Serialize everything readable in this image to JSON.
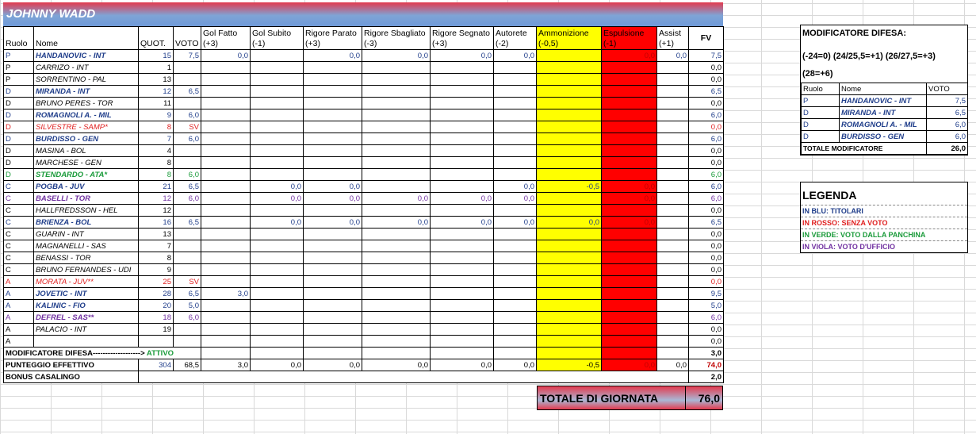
{
  "team_name": "JOHNNY WADD",
  "headers": [
    "Ruolo",
    "Nome",
    "QUOT.",
    "VOTO",
    "Gol Fatto (+3)",
    "Gol Subito (-1)",
    "Rigore Parato (+3)",
    "Rigore Sbagliato (-3)",
    "Rigore Segnato (+3)",
    "Autorete (-2)",
    "Ammonizione (-0,5)",
    "Espulsione (-1)",
    "Assist (+1)",
    "FV"
  ],
  "rows": [
    {
      "role": "P",
      "name": "HANDANOVIC - INT",
      "quot": "15",
      "voto": "7,5",
      "gf": "0,0",
      "gs": "",
      "rp": "0,0",
      "rs": "0,0",
      "rse": "0,0",
      "aut": "0,0",
      "amm": "",
      "esp": "0,0",
      "ass": "0,0",
      "fv": "7,5",
      "style": "blue"
    },
    {
      "role": "P",
      "name": "CARRIZO - INT",
      "quot": "1",
      "voto": "",
      "gf": "",
      "gs": "",
      "rp": "",
      "rs": "",
      "rse": "",
      "aut": "",
      "amm": "",
      "esp": "",
      "ass": "",
      "fv": "0,0",
      "style": "plain"
    },
    {
      "role": "P",
      "name": "SORRENTINO - PAL",
      "quot": "13",
      "voto": "",
      "gf": "",
      "gs": "",
      "rp": "",
      "rs": "",
      "rse": "",
      "aut": "",
      "amm": "",
      "esp": "",
      "ass": "",
      "fv": "0,0",
      "style": "plain"
    },
    {
      "role": "D",
      "name": "MIRANDA - INT",
      "quot": "12",
      "voto": "6,5",
      "gf": "",
      "gs": "",
      "rp": "",
      "rs": "",
      "rse": "",
      "aut": "",
      "amm": "",
      "esp": "",
      "ass": "",
      "fv": "6,5",
      "style": "blue"
    },
    {
      "role": "D",
      "name": "BRUNO PERES - TOR",
      "quot": "11",
      "voto": "",
      "gf": "",
      "gs": "",
      "rp": "",
      "rs": "",
      "rse": "",
      "aut": "",
      "amm": "",
      "esp": "",
      "ass": "",
      "fv": "0,0",
      "style": "plain"
    },
    {
      "role": "D",
      "name": "ROMAGNOLI A. - MIL",
      "quot": "9",
      "voto": "6,0",
      "gf": "",
      "gs": "",
      "rp": "",
      "rs": "",
      "rse": "",
      "aut": "",
      "amm": "",
      "esp": "",
      "ass": "",
      "fv": "6,0",
      "style": "blue"
    },
    {
      "role": "D",
      "name": "SILVESTRE - SAMP*",
      "quot": "8",
      "voto": "SV",
      "gf": "",
      "gs": "",
      "rp": "",
      "rs": "",
      "rse": "",
      "aut": "",
      "amm": "",
      "esp": "",
      "ass": "",
      "fv": "0,0",
      "style": "redt"
    },
    {
      "role": "D",
      "name": "BURDISSO - GEN",
      "quot": "7",
      "voto": "6,0",
      "gf": "",
      "gs": "",
      "rp": "",
      "rs": "",
      "rse": "",
      "aut": "",
      "amm": "",
      "esp": "",
      "ass": "",
      "fv": "6,0",
      "style": "blue"
    },
    {
      "role": "D",
      "name": "MASINA - BOL",
      "quot": "4",
      "voto": "",
      "gf": "",
      "gs": "",
      "rp": "",
      "rs": "",
      "rse": "",
      "aut": "",
      "amm": "",
      "esp": "",
      "ass": "",
      "fv": "0,0",
      "style": "plain"
    },
    {
      "role": "D",
      "name": "MARCHESE - GEN",
      "quot": "8",
      "voto": "",
      "gf": "",
      "gs": "",
      "rp": "",
      "rs": "",
      "rse": "",
      "aut": "",
      "amm": "",
      "esp": "",
      "ass": "",
      "fv": "0,0",
      "style": "plain"
    },
    {
      "role": "D",
      "name": "STENDARDO - ATA*",
      "quot": "8",
      "voto": "6,0",
      "gf": "",
      "gs": "",
      "rp": "",
      "rs": "",
      "rse": "",
      "aut": "",
      "amm": "",
      "esp": "",
      "ass": "",
      "fv": "6,0",
      "style": "green"
    },
    {
      "role": "C",
      "name": "POGBA - JUV",
      "quot": "21",
      "voto": "6,5",
      "gf": "",
      "gs": "0,0",
      "rp": "0,0",
      "rs": "",
      "rse": "",
      "aut": "0,0",
      "amm": "-0,5",
      "esp": "0,0",
      "ass": "",
      "fv": "6,0",
      "style": "blue"
    },
    {
      "role": "C",
      "name": "BASELLI - TOR",
      "quot": "12",
      "voto": "6,0",
      "gf": "",
      "gs": "0,0",
      "rp": "0,0",
      "rs": "0,0",
      "rse": "0,0",
      "aut": "0,0",
      "amm": "",
      "esp": "0,0",
      "ass": "",
      "fv": "6,0",
      "style": "viola"
    },
    {
      "role": "C",
      "name": "HALLFREDSSON - HEL",
      "quot": "12",
      "voto": "",
      "gf": "",
      "gs": "",
      "rp": "",
      "rs": "",
      "rse": "",
      "aut": "",
      "amm": "",
      "esp": "",
      "ass": "",
      "fv": "0,0",
      "style": "plain"
    },
    {
      "role": "C",
      "name": "BRIENZA - BOL",
      "quot": "16",
      "voto": "6,5",
      "gf": "",
      "gs": "0,0",
      "rp": "0,0",
      "rs": "0,0",
      "rse": "0,0",
      "aut": "0,0",
      "amm": "0,0",
      "esp": "0,0",
      "ass": "",
      "fv": "6,5",
      "style": "blue"
    },
    {
      "role": "C",
      "name": "GUARIN - INT",
      "quot": "13",
      "voto": "",
      "gf": "",
      "gs": "",
      "rp": "",
      "rs": "",
      "rse": "",
      "aut": "",
      "amm": "",
      "esp": "",
      "ass": "",
      "fv": "0,0",
      "style": "plain"
    },
    {
      "role": "C",
      "name": "MAGNANELLI - SAS",
      "quot": "7",
      "voto": "",
      "gf": "",
      "gs": "",
      "rp": "",
      "rs": "",
      "rse": "",
      "aut": "",
      "amm": "",
      "esp": "",
      "ass": "",
      "fv": "0,0",
      "style": "plain"
    },
    {
      "role": "C",
      "name": "BENASSI - TOR",
      "quot": "8",
      "voto": "",
      "gf": "",
      "gs": "",
      "rp": "",
      "rs": "",
      "rse": "",
      "aut": "",
      "amm": "",
      "esp": "",
      "ass": "",
      "fv": "0,0",
      "style": "plain"
    },
    {
      "role": "C",
      "name": "BRUNO FERNANDES - UDI",
      "quot": "9",
      "voto": "",
      "gf": "",
      "gs": "",
      "rp": "",
      "rs": "",
      "rse": "",
      "aut": "",
      "amm": "",
      "esp": "",
      "ass": "",
      "fv": "0,0",
      "style": "plain"
    },
    {
      "role": "A",
      "name": "MORATA - JUV**",
      "quot": "25",
      "voto": "SV",
      "gf": "",
      "gs": "",
      "rp": "",
      "rs": "",
      "rse": "",
      "aut": "",
      "amm": "",
      "esp": "",
      "ass": "",
      "fv": "0,0",
      "style": "redt"
    },
    {
      "role": "A",
      "name": "JOVETIC - INT",
      "quot": "28",
      "voto": "6,5",
      "gf": "3,0",
      "gs": "",
      "rp": "",
      "rs": "",
      "rse": "",
      "aut": "",
      "amm": "",
      "esp": "",
      "ass": "",
      "fv": "9,5",
      "style": "blue"
    },
    {
      "role": "A",
      "name": "KALINIC - FIO",
      "quot": "20",
      "voto": "5,0",
      "gf": "",
      "gs": "",
      "rp": "",
      "rs": "",
      "rse": "",
      "aut": "",
      "amm": "",
      "esp": "",
      "ass": "",
      "fv": "5,0",
      "style": "blue"
    },
    {
      "role": "A",
      "name": "DEFREL - SAS**",
      "quot": "18",
      "voto": "6,0",
      "gf": "",
      "gs": "",
      "rp": "",
      "rs": "",
      "rse": "",
      "aut": "",
      "amm": "",
      "esp": "",
      "ass": "",
      "fv": "6,0",
      "style": "viola"
    },
    {
      "role": "A",
      "name": "PALACIO - INT",
      "quot": "19",
      "voto": "",
      "gf": "",
      "gs": "",
      "rp": "",
      "rs": "",
      "rse": "",
      "aut": "",
      "amm": "",
      "esp": "",
      "ass": "",
      "fv": "0,0",
      "style": "plain"
    },
    {
      "role": "A",
      "name": "",
      "quot": "",
      "voto": "",
      "gf": "",
      "gs": "",
      "rp": "",
      "rs": "",
      "rse": "",
      "aut": "",
      "amm": "",
      "esp": "",
      "ass": "",
      "fv": "0,0",
      "style": "plain"
    }
  ],
  "summary": {
    "mod_label": "MODIFICATORE DIFESA------------------->",
    "mod_status": "ATTIVO",
    "mod_fv": "3,0",
    "eff_label": "PUNTEGGIO EFFETTIVO",
    "eff": {
      "quot": "304",
      "voto": "68,5",
      "gf": "3,0",
      "gs": "0,0",
      "rp": "0,0",
      "rs": "0,0",
      "rse": "0,0",
      "aut": "0,0",
      "amm": "-0,5",
      "esp": "0,0",
      "ass": "0,0",
      "fv": "74,0"
    },
    "bonus_label": "BONUS CASALINGO",
    "bonus_fv": "2,0",
    "total_label": "TOTALE DI GIORNATA",
    "total_value": "76,0"
  },
  "modifier_panel": {
    "title": "MODIFICATORE DIFESA:",
    "rule1": "(-24=0) (24/25,5=+1) (26/27,5=+3)",
    "rule2": "(28=+6)",
    "headers": [
      "Ruolo",
      "Nome",
      "VOTO"
    ],
    "rows": [
      {
        "role": "P",
        "name": "HANDANOVIC - INT",
        "voto": "7,5"
      },
      {
        "role": "D",
        "name": "MIRANDA - INT",
        "voto": "6,5"
      },
      {
        "role": "D",
        "name": "ROMAGNOLI A. - MIL",
        "voto": "6,0"
      },
      {
        "role": "D",
        "name": "BURDISSO - GEN",
        "voto": "6,0"
      }
    ],
    "total_label": "TOTALE MODIFICATORE",
    "total_value": "26,0"
  },
  "legend": {
    "title": "LEGENDA",
    "items": [
      {
        "text": "IN BLU: TITOLARI",
        "color": "#1f3d8a"
      },
      {
        "text": "IN ROSSO: SENZA VOTO",
        "color": "#e02020"
      },
      {
        "text": "IN VERDE: VOTO DALLA PANCHINA",
        "color": "#1a9b3a"
      },
      {
        "text": "IN VIOLA: VOTO D'UFFICIO",
        "color": "#7030a0"
      }
    ]
  }
}
